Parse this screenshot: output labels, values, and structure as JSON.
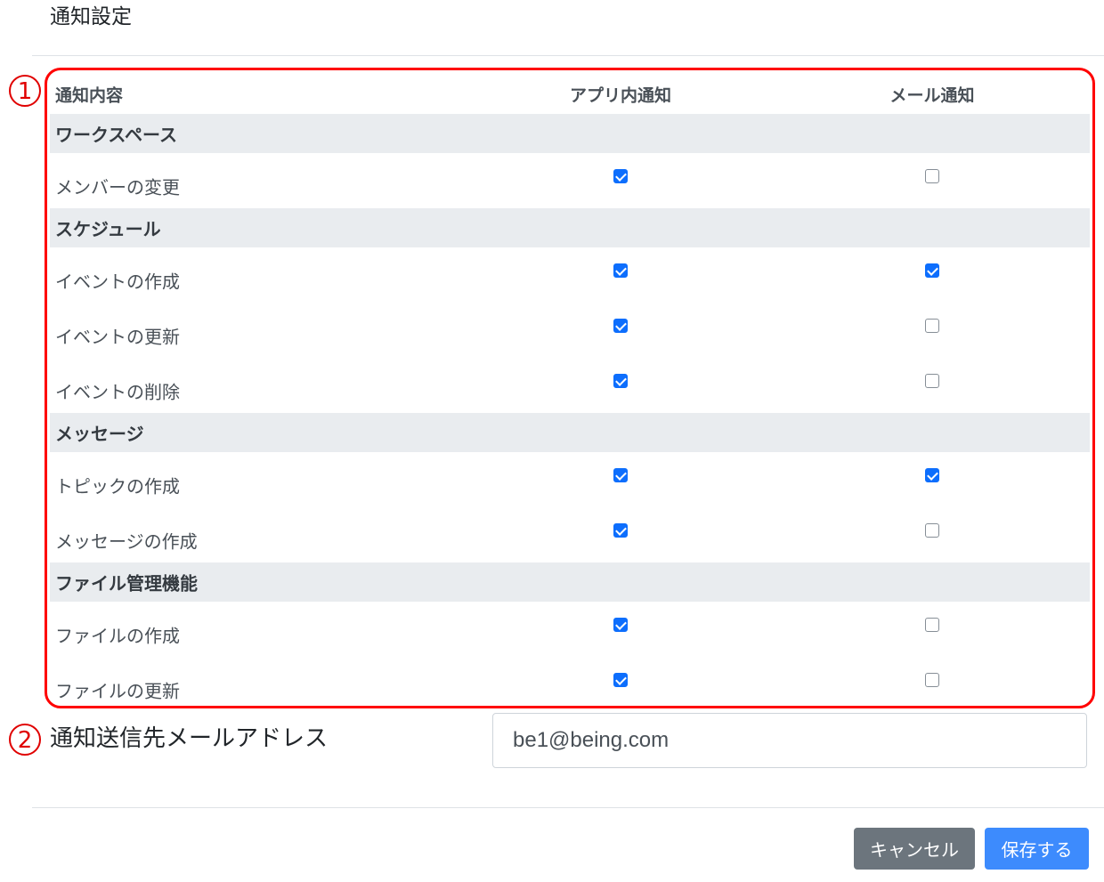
{
  "modal": {
    "title": "通知設定"
  },
  "table": {
    "headers": {
      "content": "通知内容",
      "app": "アプリ内通知",
      "mail": "メール通知"
    },
    "groups": [
      {
        "name": "ワークスペース",
        "items": [
          {
            "label": "メンバーの変更",
            "app": true,
            "mail": false
          }
        ]
      },
      {
        "name": "スケジュール",
        "items": [
          {
            "label": "イベントの作成",
            "app": true,
            "mail": true
          },
          {
            "label": "イベントの更新",
            "app": true,
            "mail": false
          },
          {
            "label": "イベントの削除",
            "app": true,
            "mail": false
          }
        ]
      },
      {
        "name": "メッセージ",
        "items": [
          {
            "label": "トピックの作成",
            "app": true,
            "mail": true
          },
          {
            "label": "メッセージの作成",
            "app": true,
            "mail": false
          }
        ]
      },
      {
        "name": "ファイル管理機能",
        "items": [
          {
            "label": "ファイルの作成",
            "app": true,
            "mail": false
          },
          {
            "label": "ファイルの更新",
            "app": true,
            "mail": false
          }
        ]
      }
    ]
  },
  "annotations": {
    "marker1": "1",
    "marker2": "2",
    "highlight_color": "#ff0000"
  },
  "email": {
    "label": "通知送信先メールアドレス",
    "value": "be1@being.com"
  },
  "footer": {
    "cancel_label": "キャンセル",
    "save_label": "保存する"
  },
  "colors": {
    "checkbox_checked": "#0d6efd",
    "group_row_bg": "#e9ecef",
    "cancel_button": "#6c757d",
    "save_button": "#3d8bfd"
  }
}
